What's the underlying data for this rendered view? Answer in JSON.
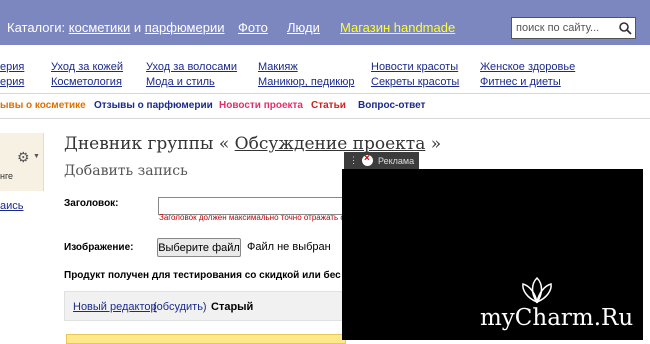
{
  "header": {
    "catalogs_prefix": "Каталоги:",
    "cosmetics": "косметики",
    "and_word": "и",
    "perfumery": "парфюмерии",
    "photo": "Фото",
    "people": "Люди",
    "shop": "Магазин handmade",
    "search_placeholder": "поиск по сайту..."
  },
  "nav": {
    "col1": [
      "ерия",
      "ерия"
    ],
    "col2": [
      "Уход за кожей",
      "Косметология"
    ],
    "col3": [
      "Уход за волосами",
      "Мода и стиль"
    ],
    "col4": [
      "Макияж",
      "Маникюр, педикюр"
    ],
    "col5": [
      "Новости красоты",
      "Секреты красоты"
    ],
    "col6": [
      "Женское здоровье",
      "Фитнес и диеты"
    ]
  },
  "subnav": {
    "reviews_cosmetics": "ывы о косметике",
    "reviews_perfumery": "Отзывы о парфюмерии",
    "project_news": "Новости проекта",
    "articles": "Статьи",
    "qa": "Вопрос-ответ"
  },
  "sidebar": {
    "text": "нге",
    "link": "аись"
  },
  "main": {
    "title_prefix": "Дневник группы «",
    "title_link": "Обсуждение проекта",
    "title_suffix": "»",
    "subtitle": "Добавить запись",
    "heading_label": "Заголовок:",
    "heading_hint": "Заголовок должен максимально точно отражать с",
    "image_label": "Изображение:",
    "choose_file": "Выберите файл",
    "file_state": "Файл не выбран",
    "product_text": "Продукт получен для тестирования со скидкой или бес",
    "editor_new": "Новый редактор",
    "editor_discuss": "(обсудить)",
    "editor_old": "Старый"
  },
  "ad": {
    "label": "Реклама",
    "watermark": "myCharm.Ru"
  },
  "colors": {
    "topbar": "#7d87bf",
    "shop_link": "#ffff33",
    "link": "#1a2a8c",
    "subnav_orange": "#e07000",
    "subnav_pink": "#e0306a",
    "subnav_red": "#d02020",
    "hint_red": "#c00000"
  }
}
